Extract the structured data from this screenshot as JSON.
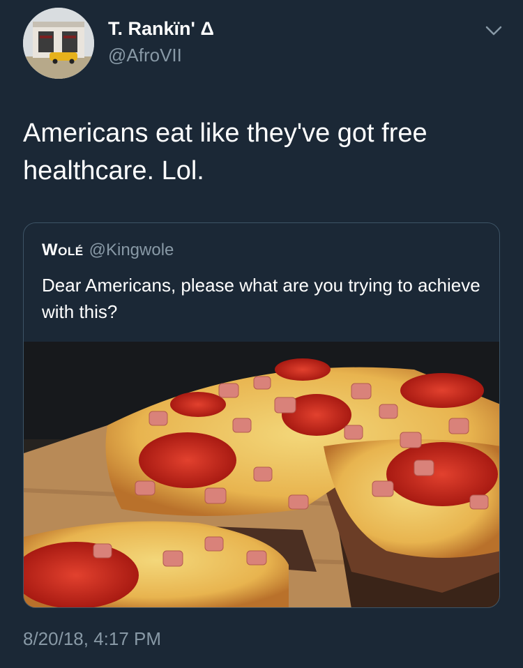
{
  "author": {
    "display_name": "T. Rankïn' Δ",
    "handle": "@AfroVII",
    "avatar_icon": "avatar-photo-icon"
  },
  "tweet": {
    "text": "Americans eat like they've got free healthcare. Lol.",
    "timestamp": "8/20/18, 4:17 PM"
  },
  "quoted_tweet": {
    "author_name": "Wolé",
    "author_handle": "@Kingwole",
    "text": "Dear Americans, please what are you trying to achieve with this?"
  },
  "icons": {
    "menu": "chevron-down-icon"
  },
  "colors": {
    "background": "#1b2836",
    "secondary_text": "#8899a6",
    "card_border": "#3d5466"
  }
}
